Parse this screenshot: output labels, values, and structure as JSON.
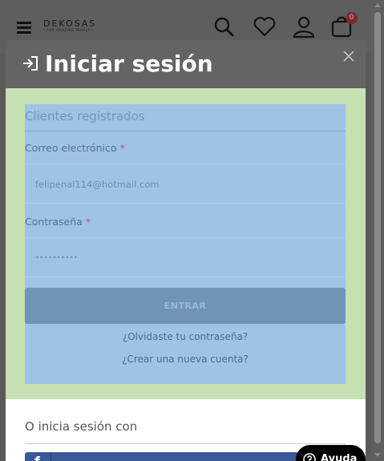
{
  "header": {
    "logo_name": "DEKOSAS",
    "logo_tagline": "• FOR AMAZING PEOPLE •",
    "cart_count": "0",
    "icons": [
      "menu-icon",
      "search-icon",
      "heart-icon",
      "user-icon",
      "bag-icon"
    ]
  },
  "modal": {
    "title": "Iniciar sesión",
    "section_title": "Clientes registrados",
    "email_label": "Correo electrónico",
    "email_value": "felipenal114@hotmail.com",
    "password_label": "Contraseña",
    "password_value": "••••••••••",
    "required_mark": "*",
    "submit_label": "ENTRAR",
    "forgot_link": "¿Olvidaste tu contraseña?",
    "create_link": "¿Crear una nueva cuenta?",
    "alt_login_title": "O inicia sesión con",
    "facebook_letter": "f"
  },
  "help": {
    "label": "Ayuda"
  },
  "colors": {
    "overlay": "#5a5a5a",
    "form_highlight": "#9fc3e7",
    "container_highlight": "#c6e0b4",
    "submit_button": "#6f94b8",
    "facebook": "#3b5998"
  }
}
